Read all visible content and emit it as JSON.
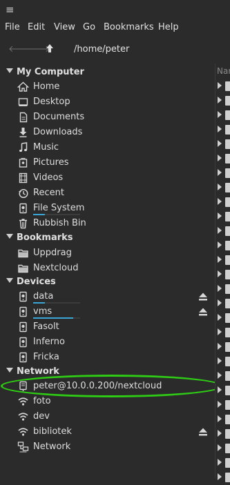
{
  "menu": [
    "File",
    "Edit",
    "View",
    "Go",
    "Bookmarks",
    "Help"
  ],
  "toolbar": {
    "path": "/home/peter"
  },
  "right_pane": {
    "column_header": "Nar",
    "row_count": 28
  },
  "sidebar": {
    "my_computer": {
      "title": "My Computer",
      "items": [
        {
          "label": "Home",
          "icon": "home-icon"
        },
        {
          "label": "Desktop",
          "icon": "desktop-icon"
        },
        {
          "label": "Documents",
          "icon": "documents-icon"
        },
        {
          "label": "Downloads",
          "icon": "downloads-icon"
        },
        {
          "label": "Music",
          "icon": "music-icon"
        },
        {
          "label": "Pictures",
          "icon": "pictures-icon"
        },
        {
          "label": "Videos",
          "icon": "videos-icon"
        },
        {
          "label": "Recent",
          "icon": "recent-icon"
        },
        {
          "label": "File System",
          "icon": "filesystem-icon",
          "usage": 0.25
        },
        {
          "label": "Rubbish Bin",
          "icon": "trash-icon"
        }
      ]
    },
    "bookmarks": {
      "title": "Bookmarks",
      "items": [
        {
          "label": "Uppdrag",
          "icon": "folder-icon"
        },
        {
          "label": "Nextcloud",
          "icon": "folder-icon"
        }
      ]
    },
    "devices": {
      "title": "Devices",
      "items": [
        {
          "label": "data",
          "icon": "drive-icon",
          "usage": 0.25,
          "eject": true
        },
        {
          "label": "vms",
          "icon": "drive-icon",
          "usage": 0.85,
          "eject": true
        },
        {
          "label": "Fasolt",
          "icon": "drive-icon"
        },
        {
          "label": "Inferno",
          "icon": "drive-icon"
        },
        {
          "label": "Fricka",
          "icon": "drive-icon"
        }
      ]
    },
    "network": {
      "title": "Network",
      "items": [
        {
          "label": "peter@10.0.0.200/nextcloud",
          "icon": "network-drive-icon"
        },
        {
          "label": "foto",
          "icon": "wifi-icon"
        },
        {
          "label": "dev",
          "icon": "wifi-icon"
        },
        {
          "label": "bibliotek",
          "icon": "wifi-icon",
          "eject": true
        },
        {
          "label": "Network",
          "icon": "network-icon"
        }
      ]
    }
  },
  "annotation": {
    "color": "#2ecc14"
  },
  "colors": {
    "background": "#2b2b2b",
    "usage_bar": "#3aa6d8",
    "text": "#dedede"
  }
}
